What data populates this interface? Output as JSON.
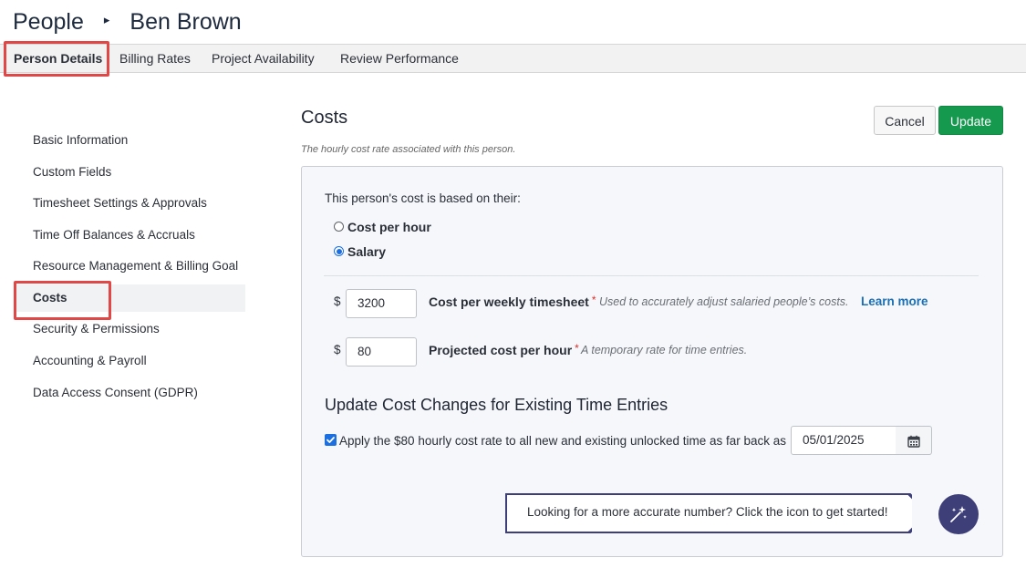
{
  "breadcrumb": {
    "root": "People",
    "separator": "▸",
    "current": "Ben Brown"
  },
  "tabs": [
    {
      "label": "Person Details",
      "active": true
    },
    {
      "label": "Billing Rates"
    },
    {
      "label": "Project Availability"
    },
    {
      "label": "Review Performance"
    }
  ],
  "sidebar": {
    "items": [
      {
        "label": "Basic Information"
      },
      {
        "label": "Custom Fields"
      },
      {
        "label": "Timesheet Settings & Approvals"
      },
      {
        "label": "Time Off Balances & Accruals"
      },
      {
        "label": "Resource Management & Billing Goal"
      },
      {
        "label": "Costs",
        "active": true
      },
      {
        "label": "Security & Permissions"
      },
      {
        "label": "Accounting & Payroll"
      },
      {
        "label": "Data Access Consent (GDPR)"
      }
    ]
  },
  "costs": {
    "title": "Costs",
    "subtitle": "The hourly cost rate associated with this person.",
    "cancel_label": "Cancel",
    "update_label": "Update",
    "basis_prompt": "This person's cost is based on their:",
    "option_hour": "Cost per hour",
    "option_salary": "Salary",
    "selected_option": "Salary",
    "currency": "$",
    "weekly_value": "3200",
    "weekly_label": "Cost per weekly timesheet",
    "weekly_help": "Used to accurately adjust salaried people’s costs.",
    "learn_more": "Learn more",
    "projected_value": "80",
    "projected_label": "Projected cost per hour",
    "projected_help": "A temporary rate for time entries.",
    "required_mark": "*",
    "section_title": "Update Cost Changes for Existing Time Entries",
    "apply_checked": true,
    "apply_text": "Apply the $80 hourly cost rate to all new and existing unlocked time as far back as",
    "date_value": "05/01/2025",
    "callout_text": "Looking for a more accurate number? Click the icon to get started!"
  },
  "colors": {
    "accent_blue": "#1b6fe0",
    "update_green": "#14994e",
    "highlight_red": "#e04848",
    "callout_navy": "#3e3f78"
  },
  "icons": {
    "calendar": "calendar-icon",
    "magic": "magic-wand-sparkle-icon",
    "check": "checkmark-icon"
  }
}
